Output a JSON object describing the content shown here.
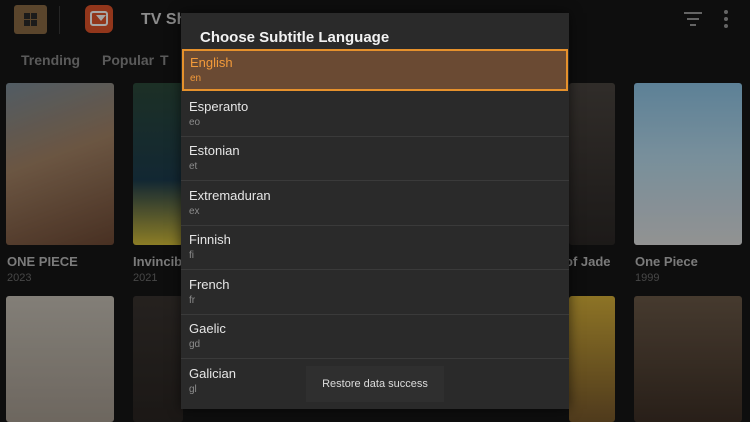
{
  "topbar": {
    "app_title": "TV Sh",
    "icons": [
      "grid-icon",
      "app-logo-icon",
      "filter-icon",
      "more-vertical-icon"
    ]
  },
  "tabs": [
    "Trending",
    "Popular",
    "T"
  ],
  "posters_row1": [
    {
      "title": "ONE PIECE",
      "year": "2023"
    },
    {
      "title": "Invincib",
      "year": "2021"
    },
    {
      "title": "of Jade",
      "year": ""
    },
    {
      "title": "One Piece",
      "year": "1999"
    }
  ],
  "dialog": {
    "title": "Choose Subtitle Language",
    "languages": [
      {
        "name": "English",
        "code": "en",
        "selected": true
      },
      {
        "name": "Esperanto",
        "code": "eo"
      },
      {
        "name": "Estonian",
        "code": "et"
      },
      {
        "name": "Extremaduran",
        "code": "ex"
      },
      {
        "name": "Finnish",
        "code": "fi"
      },
      {
        "name": "French",
        "code": "fr"
      },
      {
        "name": "Gaelic",
        "code": "gd"
      },
      {
        "name": "Galician",
        "code": "gl"
      }
    ]
  },
  "toast": {
    "message": "Restore data success"
  },
  "colors": {
    "accent": "#e6912c",
    "selected_bg": "#6a4a33",
    "dialog_bg": "#2a2a2a"
  }
}
